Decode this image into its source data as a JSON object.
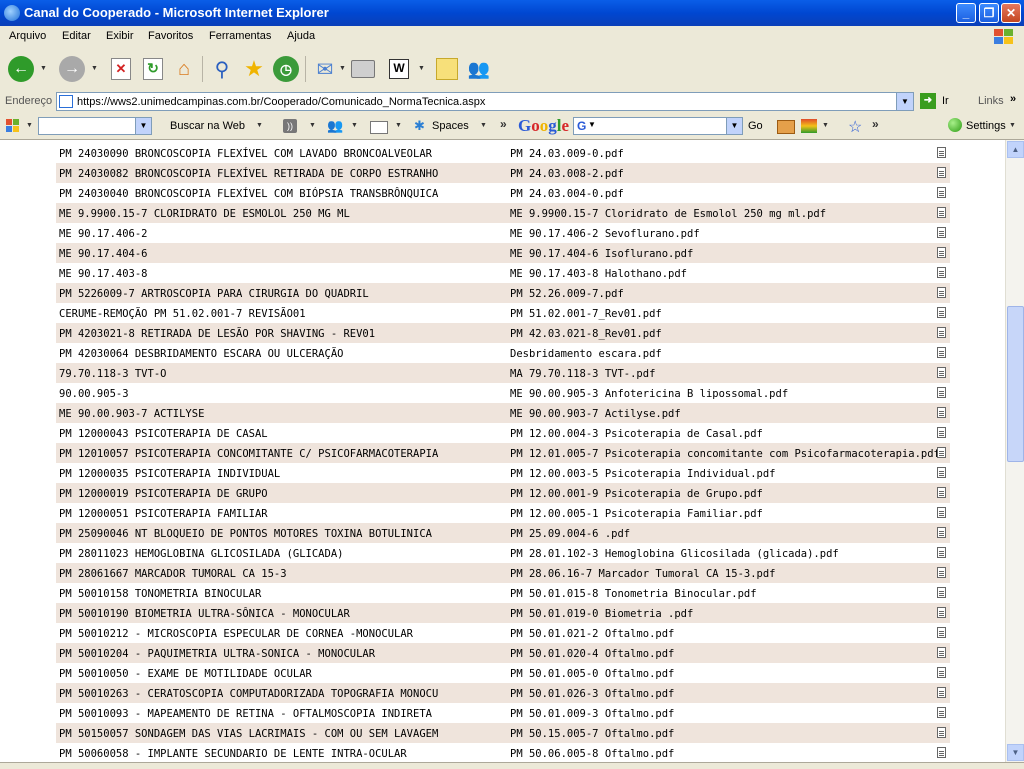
{
  "window": {
    "title": "Canal do Cooperado - Microsoft Internet Explorer"
  },
  "menu": [
    "Arquivo",
    "Editar",
    "Exibir",
    "Favoritos",
    "Ferramentas",
    "Ajuda"
  ],
  "address": {
    "label": "Endereço",
    "url": "https://wws2.unimedcampinas.com.br/Cooperado/Comunicado_NormaTecnica.aspx",
    "go_label": "Ir",
    "links_label": "Links"
  },
  "google_bar": {
    "search_web": "Buscar na Web",
    "spaces": "Spaces",
    "logo": "Google",
    "go": "Go",
    "settings": "Settings"
  },
  "rows": [
    {
      "name": "PM 24030090 BRONCOSCOPIA FLEXÍVEL COM LAVADO BRONCOALVEOLAR",
      "file": "PM 24.03.009-0.pdf"
    },
    {
      "name": "PM 24030082 BRONCOSCOPIA FLEXÍVEL RETIRADA DE CORPO ESTRANHO",
      "file": "PM 24.03.008-2.pdf"
    },
    {
      "name": "PM 24030040 BRONCOSCOPIA FLEXÍVEL COM BIÓPSIA TRANSBRÔNQUICA",
      "file": "PM 24.03.004-0.pdf"
    },
    {
      "name": "ME 9.9900.15-7 CLORIDRATO DE ESMOLOL 250 MG ML",
      "file": "ME 9.9900.15-7 Cloridrato de Esmolol 250 mg ml.pdf"
    },
    {
      "name": "ME 90.17.406-2",
      "file": "ME 90.17.406-2 Sevoflurano.pdf"
    },
    {
      "name": "ME 90.17.404-6",
      "file": "ME 90.17.404-6 Isoflurano.pdf"
    },
    {
      "name": "ME 90.17.403-8",
      "file": "ME 90.17.403-8 Halothano.pdf"
    },
    {
      "name": "PM 5226009-7 ARTROSCOPIA PARA CIRURGIA DO QUADRIL",
      "file": "PM 52.26.009-7.pdf"
    },
    {
      "name": "CERUME-REMOÇÃO PM 51.02.001-7 REVISÃO01",
      "file": "PM 51.02.001-7_Rev01.pdf"
    },
    {
      "name": "PM 4203021-8 RETIRADA DE LESÃO POR SHAVING - REV01",
      "file": "PM 42.03.021-8_Rev01.pdf"
    },
    {
      "name": "PM 42030064 DESBRIDAMENTO ESCARA OU ULCERAÇÃO",
      "file": "Desbridamento escara.pdf"
    },
    {
      "name": "79.70.118-3 TVT-O",
      "file": "MA 79.70.118-3 TVT-.pdf"
    },
    {
      "name": "90.00.905-3",
      "file": "ME 90.00.905-3 Anfotericina B lipossomal.pdf"
    },
    {
      "name": "ME 90.00.903-7 ACTILYSE",
      "file": "ME 90.00.903-7 Actilyse.pdf"
    },
    {
      "name": "PM 12000043 PSICOTERAPIA DE CASAL",
      "file": "PM 12.00.004-3 Psicoterapia de Casal.pdf"
    },
    {
      "name": "PM 12010057 PSICOTERAPIA CONCOMITANTE C/ PSICOFARMACOTERAPIA",
      "file": "PM 12.01.005-7 Psicoterapia concomitante com Psicofarmacoterapia.pdf"
    },
    {
      "name": "PM 12000035 PSICOTERAPIA INDIVIDUAL",
      "file": "PM 12.00.003-5 Psicoterapia Individual.pdf"
    },
    {
      "name": "PM 12000019 PSICOTERAPIA DE GRUPO",
      "file": "PM 12.00.001-9 Psicoterapia de Grupo.pdf"
    },
    {
      "name": "PM 12000051 PSICOTERAPIA FAMILIAR",
      "file": "PM 12.00.005-1 Psicoterapia Familiar.pdf"
    },
    {
      "name": "PM 25090046 NT BLOQUEIO DE PONTOS MOTORES TOXINA BOTULINICA",
      "file": "PM 25.09.004-6 .pdf"
    },
    {
      "name": "PM 28011023 HEMOGLOBINA GLICOSILADA (GLICADA)",
      "file": "PM 28.01.102-3 Hemoglobina Glicosilada (glicada).pdf"
    },
    {
      "name": "PM 28061667 MARCADOR TUMORAL CA 15-3",
      "file": "PM 28.06.16-7 Marcador Tumoral CA 15-3.pdf"
    },
    {
      "name": "PM 50010158 TONOMETRIA BINOCULAR",
      "file": "PM 50.01.015-8 Tonometria Binocular.pdf"
    },
    {
      "name": "PM 50010190 BIOMETRIA ULTRA-SÔNICA - MONOCULAR",
      "file": "PM 50.01.019-0 Biometria .pdf"
    },
    {
      "name": "PM 50010212 - MICROSCOPIA ESPECULAR DE CORNEA -MONOCULAR",
      "file": "PM 50.01.021-2 Oftalmo.pdf"
    },
    {
      "name": "PM 50010204 - PAQUIMETRIA ULTRA-SONICA - MONOCULAR",
      "file": "PM 50.01.020-4 Oftalmo.pdf"
    },
    {
      "name": "PM 50010050 - EXAME DE MOTILIDADE OCULAR",
      "file": "PM 50.01.005-0 Oftalmo.pdf"
    },
    {
      "name": "PM 50010263 - CERATOSCOPIA COMPUTADORIZADA TOPOGRAFIA MONOCU",
      "file": "PM 50.01.026-3 Oftalmo.pdf"
    },
    {
      "name": "PM 50010093 - MAPEAMENTO DE RETINA - OFTALMOSCOPIA INDIRETA",
      "file": "PM 50.01.009-3 Oftalmo.pdf"
    },
    {
      "name": "PM 50150057 SONDAGEM DAS VIAS LACRIMAIS - COM OU SEM LAVAGEM",
      "file": "PM 50.15.005-7 Oftalmo.pdf"
    },
    {
      "name": "PM 50060058 - IMPLANTE SECUNDARIO DE LENTE INTRA-OCULAR",
      "file": "PM 50.06.005-8 Oftalmo.pdf"
    }
  ]
}
